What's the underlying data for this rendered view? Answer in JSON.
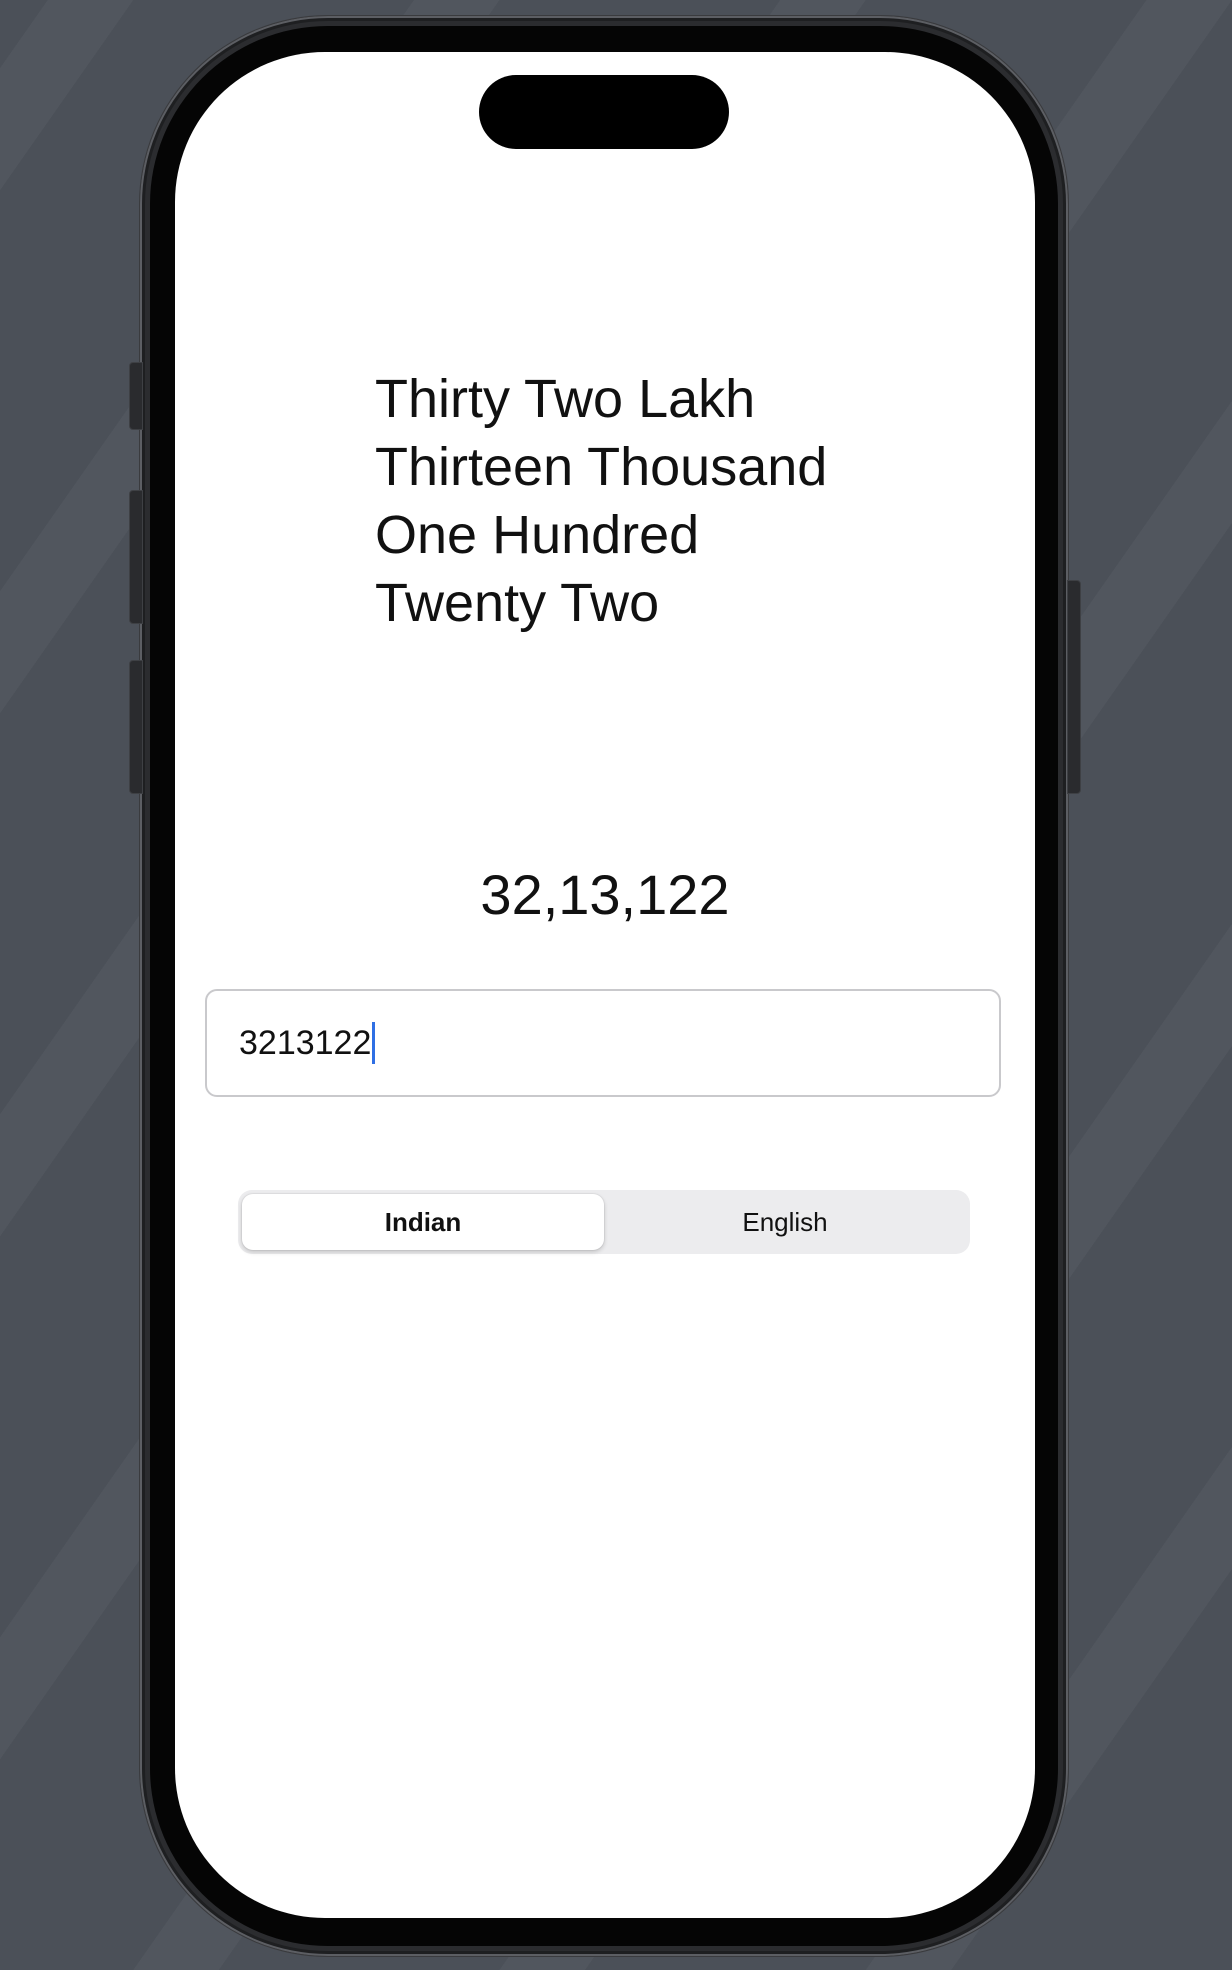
{
  "app": {
    "number_in_words_lines": [
      "Thirty Two Lakh",
      "Thirteen Thousand",
      "One Hundred",
      "Twenty Two"
    ],
    "formatted_number": "32,13,122",
    "input": {
      "value": "3213122",
      "caret_color": "#2f6fe4"
    },
    "segmented_control": {
      "options": [
        {
          "label": "Indian",
          "selected": true
        },
        {
          "label": "English",
          "selected": false
        }
      ]
    }
  },
  "colors": {
    "background": "#4b5058",
    "screen": "#ffffff",
    "text": "#111111",
    "segment_track": "#ececee"
  }
}
